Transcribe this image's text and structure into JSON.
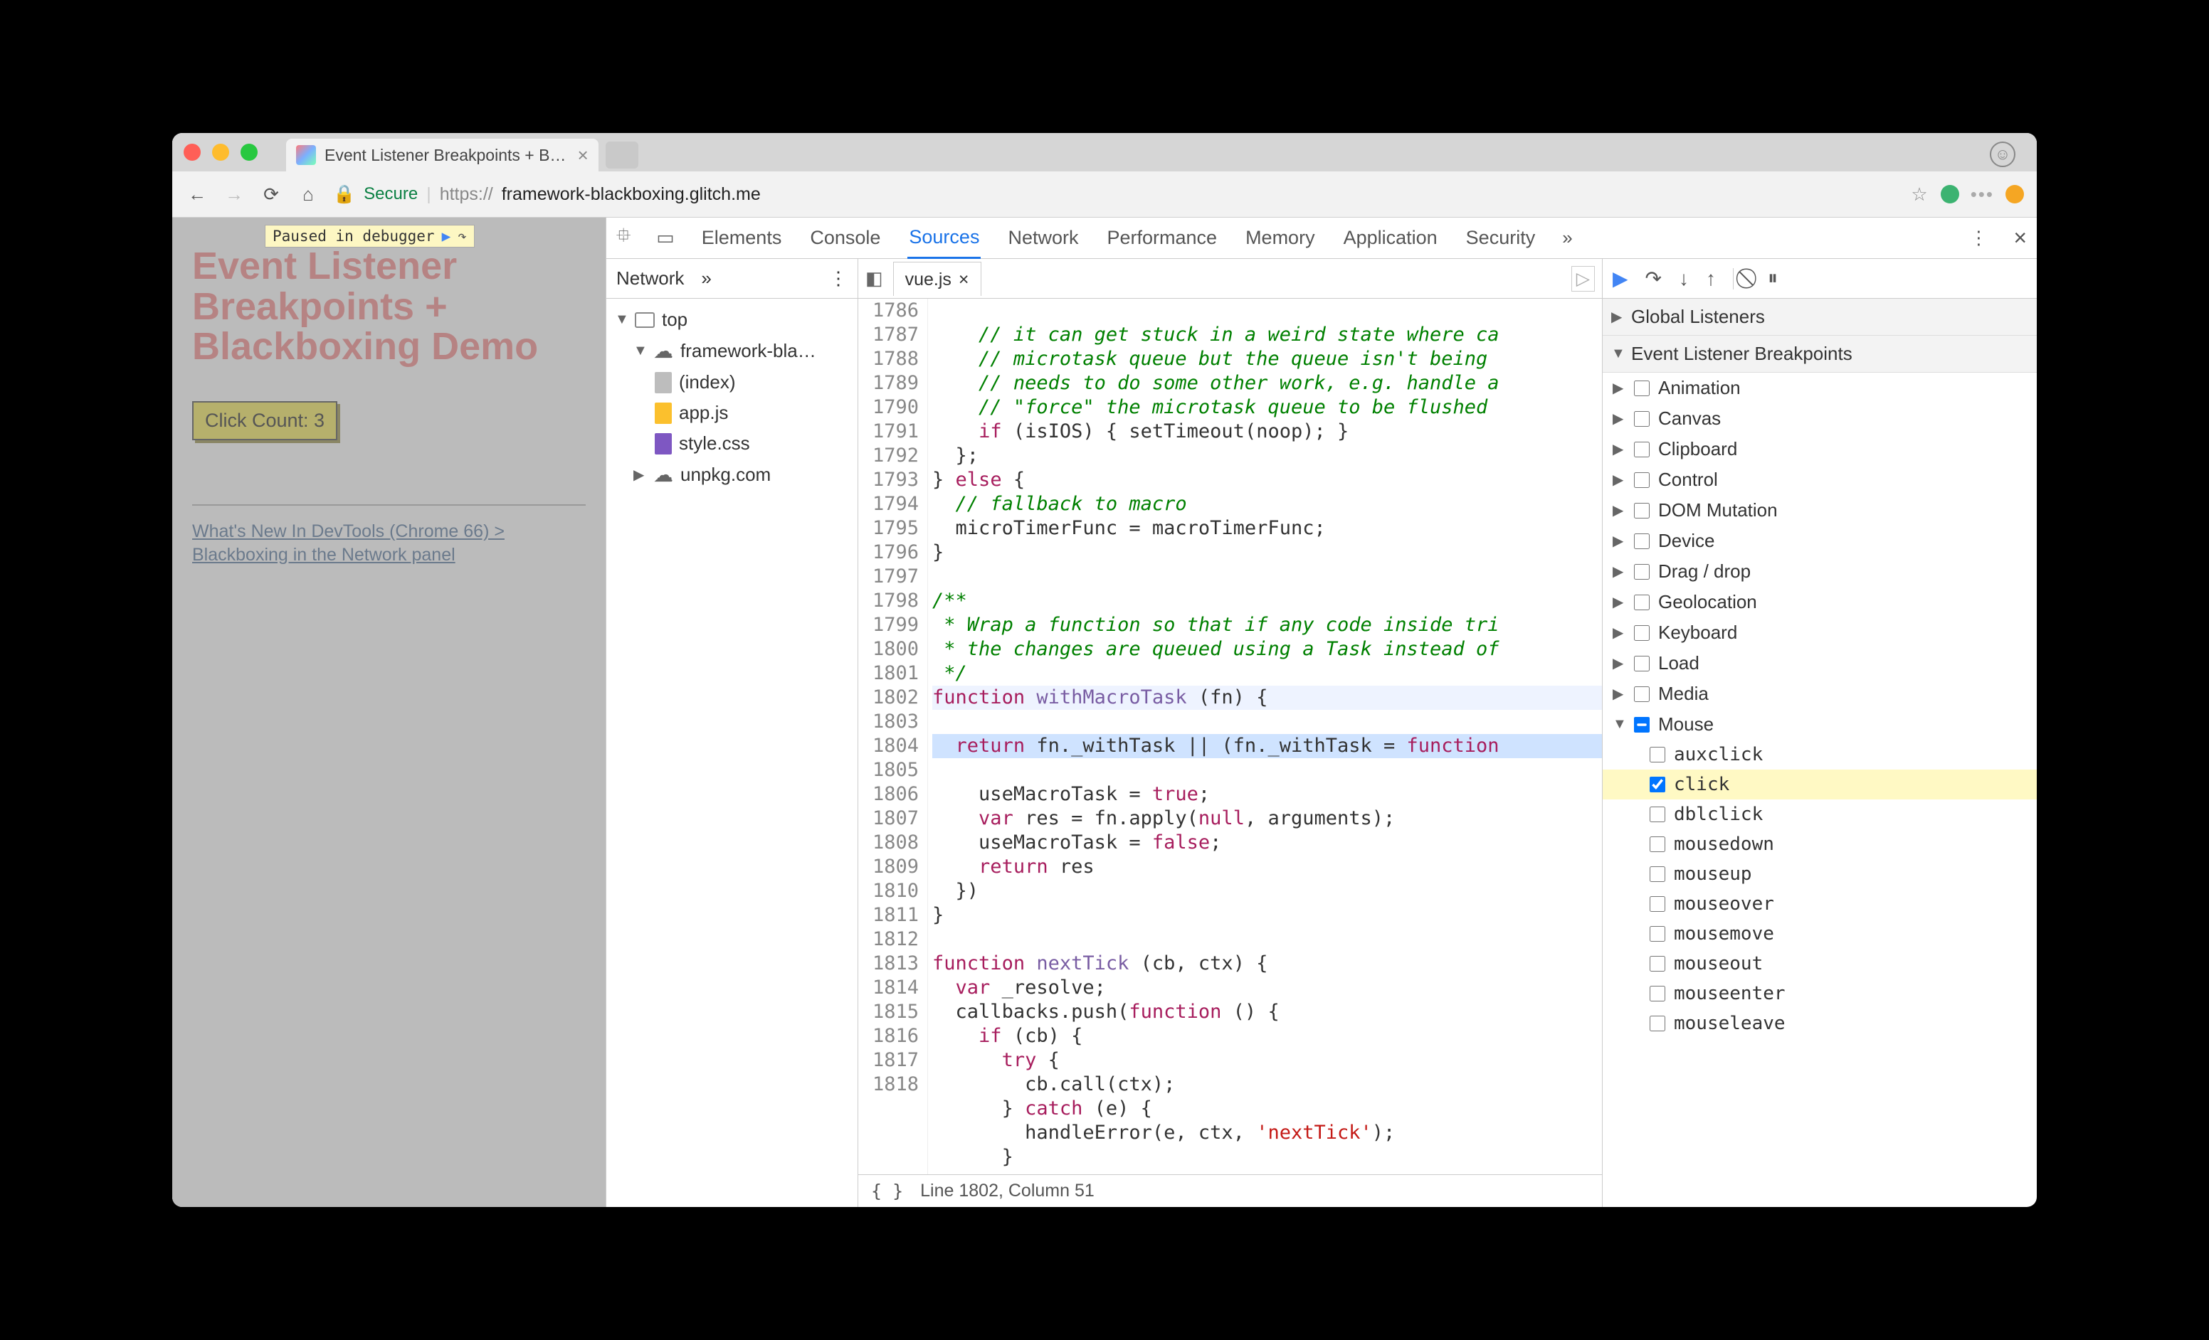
{
  "browser": {
    "tabTitle": "Event Listener Breakpoints + B…",
    "secureText": "Secure",
    "urlPrefix": "https://",
    "urlHost": "framework-blackboxing.glitch.me"
  },
  "page": {
    "title": "Event Listener Breakpoints + Blackboxing Demo",
    "clickCountLabel": "Click Count: 3",
    "linkText": "What's New In DevTools (Chrome 66) > Blackboxing in the Network panel",
    "pausedBadge": "Paused in debugger"
  },
  "devtoolsTabs": {
    "elements": "Elements",
    "console": "Console",
    "sources": "Sources",
    "network": "Network",
    "performance": "Performance",
    "memory": "Memory",
    "application": "Application",
    "security": "Security"
  },
  "navigator": {
    "panelName": "Network",
    "top": "top",
    "host": "framework-bla…",
    "indexFile": "(index)",
    "appFile": "app.js",
    "styleFile": "style.css",
    "unpkg": "unpkg.com"
  },
  "file": {
    "tabName": "vue.js",
    "lineNumbers": [
      "1786",
      "1787",
      "1788",
      "1789",
      "1790",
      "1791",
      "1792",
      "1793",
      "1794",
      "1795",
      "1796",
      "1797",
      "1798",
      "1799",
      "1800",
      "1801",
      "1802",
      "1803",
      "1804",
      "1805",
      "1806",
      "1807",
      "1808",
      "1809",
      "1810",
      "1811",
      "1812",
      "1813",
      "1814",
      "1815",
      "1816",
      "1817",
      "1818"
    ],
    "statusLine": "Line 1802, Column 51"
  },
  "code": {
    "l1786": "    // it can get stuck in a weird state where ca",
    "l1787": "    // microtask queue but the queue isn't being ",
    "l1788": "    // needs to do some other work, e.g. handle a",
    "l1789": "    // \"force\" the microtask queue to be flushed ",
    "l1790a": "if",
    "l1790b": " (isIOS) { setTimeout(noop); }",
    "l1791": "  };",
    "l1792a": "} ",
    "l1792b": "else",
    "l1792c": " {",
    "l1793": "  // fallback to macro",
    "l1794": "  microTimerFunc = macroTimerFunc;",
    "l1795": "}",
    "l1797": "/**",
    "l1798": " * Wrap a function so that if any code inside tri",
    "l1799": " * the changes are queued using a Task instead of",
    "l1800": " */",
    "l1801a": "function",
    "l1801b": " withMacroTask",
    "l1801c": " (fn) {",
    "l1802a": "  return",
    "l1802b": " fn._withTask || (fn._withTask = ",
    "l1802c": "function",
    "l1803a": "    useMacroTask = ",
    "l1803b": "true",
    "l1803c": ";",
    "l1804a": "    var",
    "l1804b": " res = fn.apply(",
    "l1804c": "null",
    "l1804d": ", arguments);",
    "l1805a": "    useMacroTask = ",
    "l1805b": "false",
    "l1805c": ";",
    "l1806a": "    return",
    "l1806b": " res",
    "l1807": "  })",
    "l1808": "}",
    "l1810a": "function",
    "l1810b": " nextTick",
    "l1810c": " (cb, ctx) {",
    "l1811a": "  var",
    "l1811b": " _resolve;",
    "l1812a": "  callbacks.push(",
    "l1812b": "function",
    "l1812c": " () {",
    "l1813a": "    if",
    "l1813b": " (cb) {",
    "l1814a": "      try",
    "l1814b": " {",
    "l1815": "        cb.call(ctx);",
    "l1816a": "      } ",
    "l1816b": "catch",
    "l1816c": " (e) {",
    "l1817a": "        handleError(e, ctx, ",
    "l1817b": "'nextTick'",
    "l1817c": ");",
    "l1818": "      }"
  },
  "debugger": {
    "globalListeners": "Global Listeners",
    "eventListenerBreakpoints": "Event Listener Breakpoints",
    "categories": {
      "animation": "Animation",
      "canvas": "Canvas",
      "clipboard": "Clipboard",
      "control": "Control",
      "dom": "DOM Mutation",
      "device": "Device",
      "drag": "Drag / drop",
      "geo": "Geolocation",
      "keyboard": "Keyboard",
      "load": "Load",
      "media": "Media",
      "mouse": "Mouse"
    },
    "mouseEvents": {
      "auxclick": "auxclick",
      "click": "click",
      "dblclick": "dblclick",
      "mousedown": "mousedown",
      "mouseup": "mouseup",
      "mouseover": "mouseover",
      "mousemove": "mousemove",
      "mouseout": "mouseout",
      "mouseenter": "mouseenter",
      "mouseleave": "mouseleave"
    }
  }
}
